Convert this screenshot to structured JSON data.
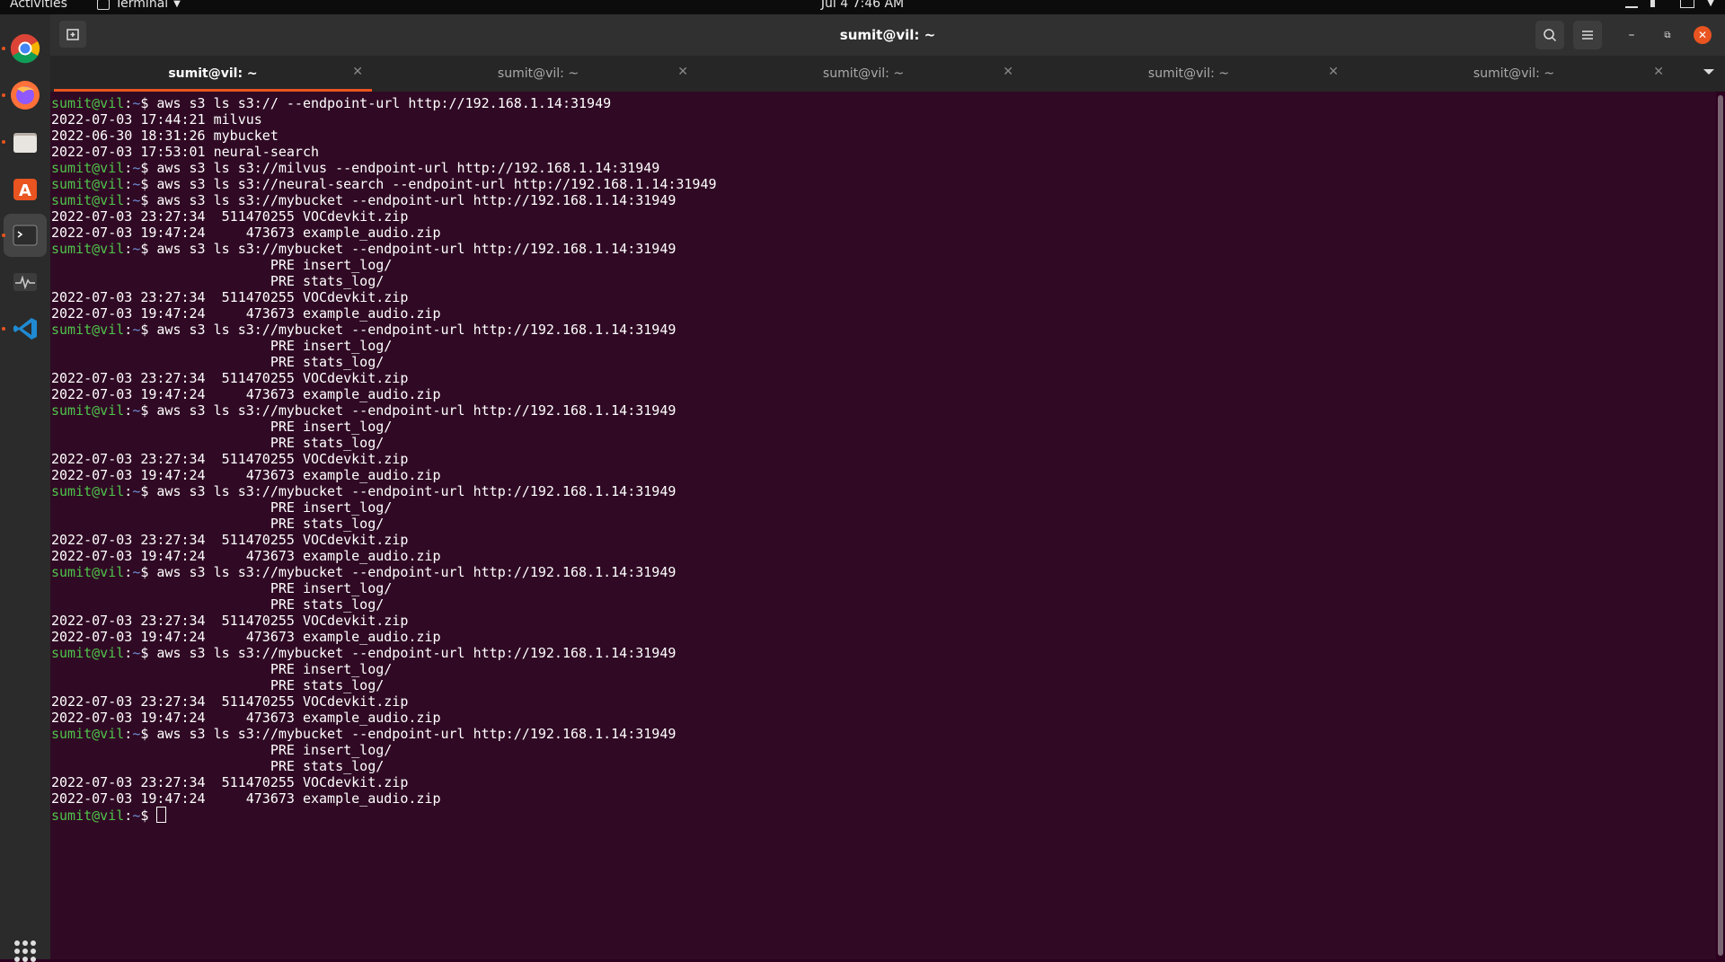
{
  "topbar": {
    "activities": "Activities",
    "app_name": "Terminal",
    "clock": "Jul 4  7:46 AM"
  },
  "dock": {
    "items": [
      "chrome-icon",
      "firefox-icon",
      "files-icon",
      "software-icon",
      "terminal-icon",
      "system-monitor-icon",
      "vscode-icon"
    ]
  },
  "window": {
    "title": "sumit@vil: ~"
  },
  "tabs": [
    {
      "label": "sumit@vil: ~",
      "active": true
    },
    {
      "label": "sumit@vil: ~",
      "active": false
    },
    {
      "label": "sumit@vil: ~",
      "active": false
    },
    {
      "label": "sumit@vil: ~",
      "active": false
    },
    {
      "label": "sumit@vil: ~",
      "active": false
    }
  ],
  "terminal": {
    "prompt_user": "sumit@vil",
    "prompt_path": "~",
    "lines": [
      {
        "cmd": "aws s3 ls s3:// --endpoint-url http://192.168.1.14:31949"
      },
      {
        "out": "2022-07-03 17:44:21 milvus"
      },
      {
        "out": "2022-06-30 18:31:26 mybucket"
      },
      {
        "out": "2022-07-03 17:53:01 neural-search"
      },
      {
        "cmd": "aws s3 ls s3://milvus --endpoint-url http://192.168.1.14:31949"
      },
      {
        "cmd": "aws s3 ls s3://neural-search --endpoint-url http://192.168.1.14:31949"
      },
      {
        "cmd": "aws s3 ls s3://mybucket --endpoint-url http://192.168.1.14:31949"
      },
      {
        "out": "2022-07-03 23:27:34  511470255 VOCdevkit.zip"
      },
      {
        "out": "2022-07-03 19:47:24     473673 example_audio.zip"
      },
      {
        "cmd": "aws s3 ls s3://mybucket --endpoint-url http://192.168.1.14:31949"
      },
      {
        "out": "                           PRE insert_log/"
      },
      {
        "out": "                           PRE stats_log/"
      },
      {
        "out": "2022-07-03 23:27:34  511470255 VOCdevkit.zip"
      },
      {
        "out": "2022-07-03 19:47:24     473673 example_audio.zip"
      },
      {
        "cmd": "aws s3 ls s3://mybucket --endpoint-url http://192.168.1.14:31949"
      },
      {
        "out": "                           PRE insert_log/"
      },
      {
        "out": "                           PRE stats_log/"
      },
      {
        "out": "2022-07-03 23:27:34  511470255 VOCdevkit.zip"
      },
      {
        "out": "2022-07-03 19:47:24     473673 example_audio.zip"
      },
      {
        "cmd": "aws s3 ls s3://mybucket --endpoint-url http://192.168.1.14:31949"
      },
      {
        "out": "                           PRE insert_log/"
      },
      {
        "out": "                           PRE stats_log/"
      },
      {
        "out": "2022-07-03 23:27:34  511470255 VOCdevkit.zip"
      },
      {
        "out": "2022-07-03 19:47:24     473673 example_audio.zip"
      },
      {
        "cmd": "aws s3 ls s3://mybucket --endpoint-url http://192.168.1.14:31949"
      },
      {
        "out": "                           PRE insert_log/"
      },
      {
        "out": "                           PRE stats_log/"
      },
      {
        "out": "2022-07-03 23:27:34  511470255 VOCdevkit.zip"
      },
      {
        "out": "2022-07-03 19:47:24     473673 example_audio.zip"
      },
      {
        "cmd": "aws s3 ls s3://mybucket --endpoint-url http://192.168.1.14:31949"
      },
      {
        "out": "                           PRE insert_log/"
      },
      {
        "out": "                           PRE stats_log/"
      },
      {
        "out": "2022-07-03 23:27:34  511470255 VOCdevkit.zip"
      },
      {
        "out": "2022-07-03 19:47:24     473673 example_audio.zip"
      },
      {
        "cmd": "aws s3 ls s3://mybucket --endpoint-url http://192.168.1.14:31949"
      },
      {
        "out": "                           PRE insert_log/"
      },
      {
        "out": "                           PRE stats_log/"
      },
      {
        "out": "2022-07-03 23:27:34  511470255 VOCdevkit.zip"
      },
      {
        "out": "2022-07-03 19:47:24     473673 example_audio.zip"
      },
      {
        "cmd": "aws s3 ls s3://mybucket --endpoint-url http://192.168.1.14:31949"
      },
      {
        "out": "                           PRE insert_log/"
      },
      {
        "out": "                           PRE stats_log/"
      },
      {
        "out": "2022-07-03 23:27:34  511470255 VOCdevkit.zip"
      },
      {
        "out": "2022-07-03 19:47:24     473673 example_audio.zip"
      },
      {
        "cmd": "",
        "cursor": true
      }
    ]
  },
  "colors": {
    "terminal_bg": "#300a24",
    "prompt_green": "#4fc34b",
    "accent_orange": "#e95420"
  }
}
